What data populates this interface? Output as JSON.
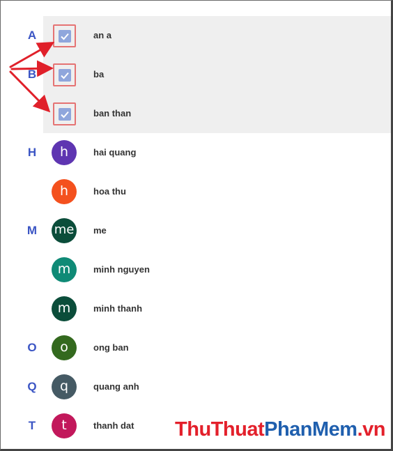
{
  "contacts": [
    {
      "letter": "A",
      "name": "an a",
      "avatar": "",
      "color": "",
      "selected": true
    },
    {
      "letter": "B",
      "name": "ba",
      "avatar": "",
      "color": "",
      "selected": true
    },
    {
      "letter": "",
      "name": "ban than",
      "avatar": "",
      "color": "",
      "selected": true
    },
    {
      "letter": "H",
      "name": "hai quang",
      "avatar": "h",
      "color": "#5e35b1",
      "selected": false
    },
    {
      "letter": "",
      "name": "hoa thu",
      "avatar": "h",
      "color": "#f4511e",
      "selected": false
    },
    {
      "letter": "M",
      "name": "me",
      "avatar": "me",
      "color": "#0b4d3a",
      "selected": false
    },
    {
      "letter": "",
      "name": "minh nguyen",
      "avatar": "m",
      "color": "#0f8a76",
      "selected": false
    },
    {
      "letter": "",
      "name": "minh thanh",
      "avatar": "m",
      "color": "#0b4d3a",
      "selected": false
    },
    {
      "letter": "O",
      "name": "ong ban",
      "avatar": "o",
      "color": "#33691e",
      "selected": false
    },
    {
      "letter": "Q",
      "name": "quang anh",
      "avatar": "q",
      "color": "#455a64",
      "selected": false
    },
    {
      "letter": "T",
      "name": "thanh dat",
      "avatar": "t",
      "color": "#c2185b",
      "selected": false
    }
  ],
  "watermark": {
    "part1": "ThuThuat",
    "part2": "PhanMem",
    "part3": ".vn"
  },
  "colors": {
    "accent": "#3b55c4",
    "selected_bg": "#efefef",
    "checkbox": "#8fa6dc",
    "arrow": "#e0202a"
  }
}
